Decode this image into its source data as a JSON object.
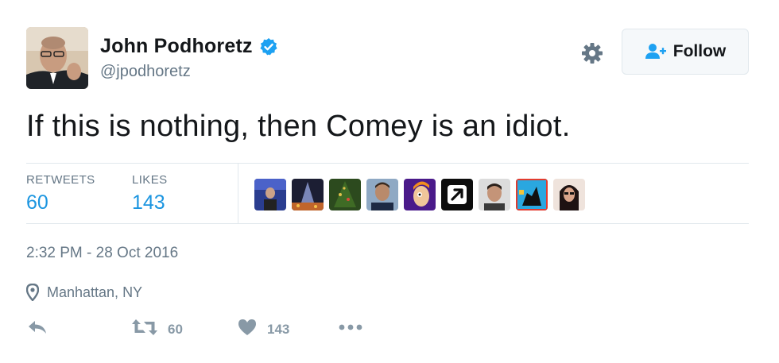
{
  "author": {
    "display_name": "John Podhoretz",
    "handle": "@jpodhoretz",
    "verified": true
  },
  "header": {
    "settings_icon": "gear-icon",
    "follow_label": "Follow",
    "follow_icon": "add-user-icon"
  },
  "tweet": {
    "text": "If this is nothing, then Comey is an idiot."
  },
  "stats": {
    "retweets_label": "RETWEETS",
    "retweets_value": "60",
    "likes_label": "LIKES",
    "likes_value": "143",
    "liker_count_shown": 9
  },
  "meta": {
    "timestamp": "2:32 PM - 28 Oct 2016",
    "location": "Manhattan, NY",
    "location_icon": "map-pin-icon"
  },
  "actions": {
    "reply_icon": "reply-icon",
    "retweet_icon": "retweet-icon",
    "retweet_count": "60",
    "like_icon": "heart-icon",
    "like_count": "143",
    "more_icon": "more-dots-icon"
  },
  "colors": {
    "text_primary": "#14171a",
    "text_secondary": "#657786",
    "action_gray": "#8899a6",
    "link_blue": "#1b95e0",
    "verified_blue": "#1da1f2",
    "border": "#e1e8ed"
  }
}
